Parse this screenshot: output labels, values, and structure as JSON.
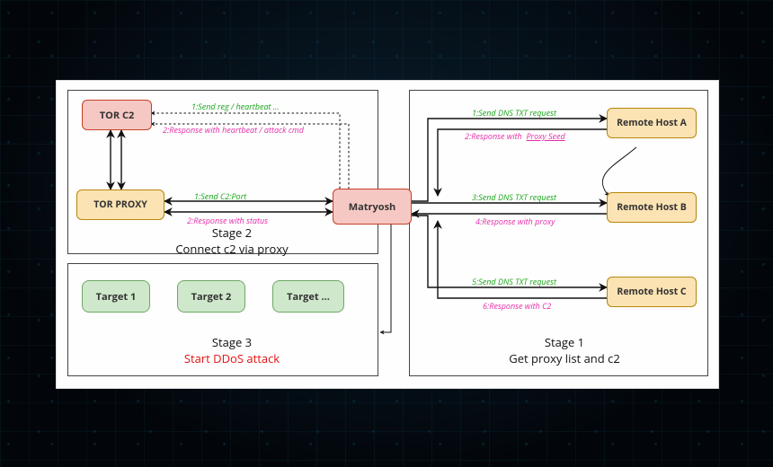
{
  "nodes": {
    "matryosh": "Matryosh",
    "tor_c2": "TOR C2",
    "tor_proxy": "TOR PROXY",
    "remote_host_a": "Remote Host A",
    "remote_host_b": "Remote Host B",
    "remote_host_c": "Remote Host C",
    "target_1": "Target 1",
    "target_2": "Target 2",
    "target_more": "Target ..."
  },
  "labels": {
    "s2_l1": "1:Send reg / heartbeat ...",
    "s2_l2": "2:Response with heartbeat / attack cmd",
    "s2_l3": "1:Send C2:Port",
    "s2_l4": "2:Response with status",
    "s1_l1": "1:Send DNS TXT request",
    "s1_l2a": "2:Response with",
    "s1_l2b": "Proxy Seed",
    "s1_l3": "3:Send DNS TXT request",
    "s1_l4": "4:Response with proxy",
    "s1_l5": "5:Send DNS TXT request",
    "s1_l6": "6:Response with C2"
  },
  "stages": {
    "s1_title": "Stage 1",
    "s1_sub": "Get proxy list and c2",
    "s2_title": "Stage 2",
    "s2_sub": "Connect c2 via proxy",
    "s3_title": "Stage 3",
    "s3_sub": "Start DDoS attack"
  },
  "chart_data": {
    "type": "diagram",
    "title": "Matryosh botnet three-stage operation flow",
    "nodes": [
      {
        "id": "matryosh",
        "label": "Matryosh",
        "role": "malware",
        "color": "pink"
      },
      {
        "id": "tor_c2",
        "label": "TOR C2",
        "role": "c2-server",
        "color": "pink"
      },
      {
        "id": "tor_proxy",
        "label": "TOR PROXY",
        "role": "proxy",
        "color": "yellow"
      },
      {
        "id": "remote_host_a",
        "label": "Remote Host A",
        "role": "dns-host",
        "color": "yellow"
      },
      {
        "id": "remote_host_b",
        "label": "Remote Host B",
        "role": "dns-host",
        "color": "yellow"
      },
      {
        "id": "remote_host_c",
        "label": "Remote Host C",
        "role": "dns-host",
        "color": "yellow"
      },
      {
        "id": "target_1",
        "label": "Target 1",
        "role": "ddos-target",
        "color": "green"
      },
      {
        "id": "target_2",
        "label": "Target 2",
        "role": "ddos-target",
        "color": "green"
      },
      {
        "id": "target_more",
        "label": "Target ...",
        "role": "ddos-target",
        "color": "green"
      }
    ],
    "stages": [
      {
        "id": 1,
        "title": "Stage 1",
        "subtitle": "Get proxy list and c2",
        "flows": [
          {
            "from": "matryosh",
            "to": "remote_host_a",
            "step": 1,
            "dir": "request",
            "label": "Send DNS TXT request"
          },
          {
            "from": "remote_host_a",
            "to": "matryosh",
            "step": 2,
            "dir": "response",
            "label": "Response with Proxy Seed"
          },
          {
            "from": "matryosh",
            "to": "remote_host_b",
            "step": 3,
            "dir": "request",
            "label": "Send DNS TXT request"
          },
          {
            "from": "remote_host_b",
            "to": "matryosh",
            "step": 4,
            "dir": "response",
            "label": "Response with proxy"
          },
          {
            "from": "matryosh",
            "to": "remote_host_c",
            "step": 5,
            "dir": "request",
            "label": "Send DNS TXT request"
          },
          {
            "from": "remote_host_c",
            "to": "matryosh",
            "step": 6,
            "dir": "response",
            "label": "Response with C2"
          }
        ],
        "side_arrow": {
          "from": "remote_host_a",
          "to": "remote_host_b",
          "style": "curved"
        }
      },
      {
        "id": 2,
        "title": "Stage 2",
        "subtitle": "Connect c2 via proxy",
        "flows": [
          {
            "from": "matryosh",
            "to": "tor_c2",
            "step": 1,
            "dir": "request",
            "label": "Send reg / heartbeat ...",
            "style": "dashed"
          },
          {
            "from": "tor_c2",
            "to": "matryosh",
            "step": 2,
            "dir": "response",
            "label": "Response with heartbeat / attack cmd",
            "style": "dashed"
          },
          {
            "from": "tor_proxy",
            "to": "matryosh",
            "step": 1,
            "dir": "request",
            "label": "Send C2:Port"
          },
          {
            "from": "matryosh",
            "to": "tor_proxy",
            "step": 2,
            "dir": "response",
            "label": "Response with status"
          },
          {
            "from": "tor_proxy",
            "to": "tor_c2",
            "style": "bidirectional"
          }
        ]
      },
      {
        "id": 3,
        "title": "Stage 3",
        "subtitle": "Start DDoS attack",
        "flows": [
          {
            "from": "matryosh",
            "to": "target_panel",
            "style": "solid-arrow"
          }
        ]
      }
    ]
  }
}
